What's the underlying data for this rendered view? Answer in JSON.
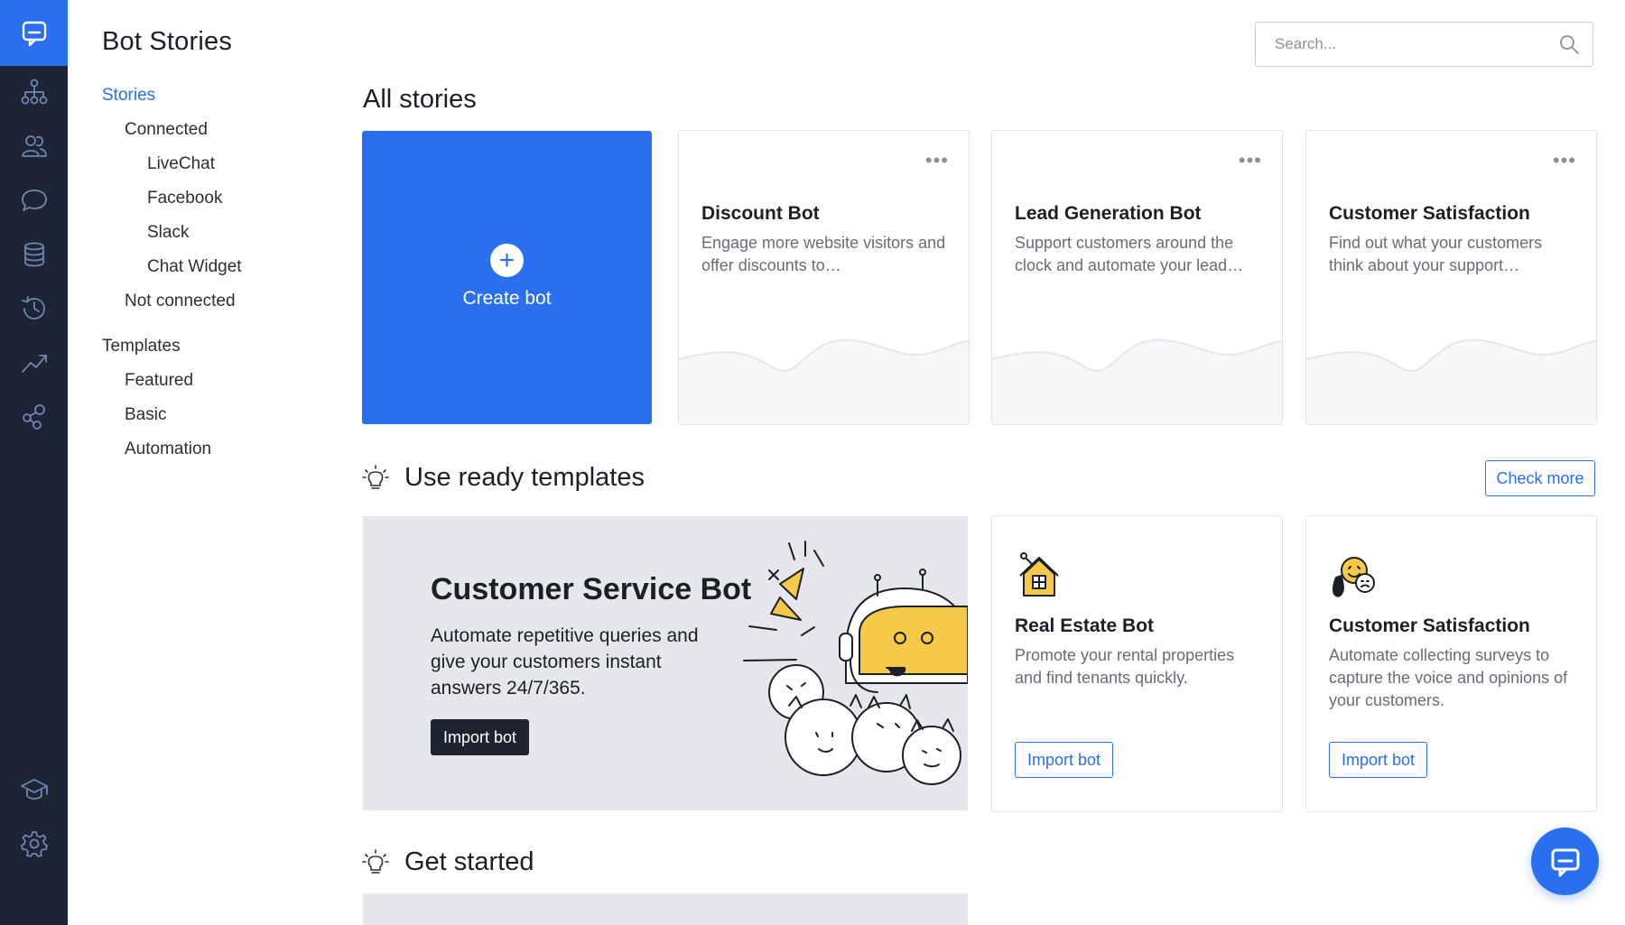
{
  "sidebar": {
    "items": [
      {
        "icon": "bot-stories-icon"
      },
      {
        "icon": "customers-icon"
      },
      {
        "icon": "chats-icon"
      },
      {
        "icon": "database-icon"
      },
      {
        "icon": "history-icon"
      },
      {
        "icon": "reports-icon"
      },
      {
        "icon": "integrations-icon"
      }
    ],
    "bottom": [
      {
        "icon": "learn-icon"
      },
      {
        "icon": "settings-icon"
      }
    ]
  },
  "nav": {
    "title": "Bot Stories",
    "stories": "Stories",
    "connected": "Connected",
    "livechat": "LiveChat",
    "facebook": "Facebook",
    "slack": "Slack",
    "chat_widget": "Chat Widget",
    "not_connected": "Not connected",
    "templates": "Templates",
    "featured": "Featured",
    "basic": "Basic",
    "automation": "Automation"
  },
  "search": {
    "placeholder": "Search..."
  },
  "all_stories": {
    "title": "All stories",
    "create_label": "Create bot",
    "cards": [
      {
        "title": "Discount Bot",
        "desc": "Engage more website visitors and offer discounts to…"
      },
      {
        "title": "Lead Generation Bot",
        "desc": "Support customers around the clock and automate your lead…"
      },
      {
        "title": "Customer Satisfaction",
        "desc": "Find out what your customers think about your support…"
      }
    ]
  },
  "templates": {
    "title": "Use ready templates",
    "check_more": "Check more",
    "featured": {
      "title": "Customer Service Bot",
      "desc": "Automate repetitive queries and give your customers instant answers 24/7/365.",
      "button": "Import bot"
    },
    "cards": [
      {
        "title": "Real Estate Bot",
        "desc": "Promote your rental properties and find tenants quickly.",
        "button": "Import bot",
        "icon": "house-icon"
      },
      {
        "title": "Customer Satisfaction",
        "desc": "Automate collecting surveys to capture the voice and opinions of your customers.",
        "button": "Import bot",
        "icon": "smiley-faces-icon"
      }
    ]
  },
  "get_started": {
    "title": "Get started"
  },
  "colors": {
    "accent": "#2a6ff0",
    "rail": "#1c2435",
    "dark_button": "#1d232f"
  }
}
